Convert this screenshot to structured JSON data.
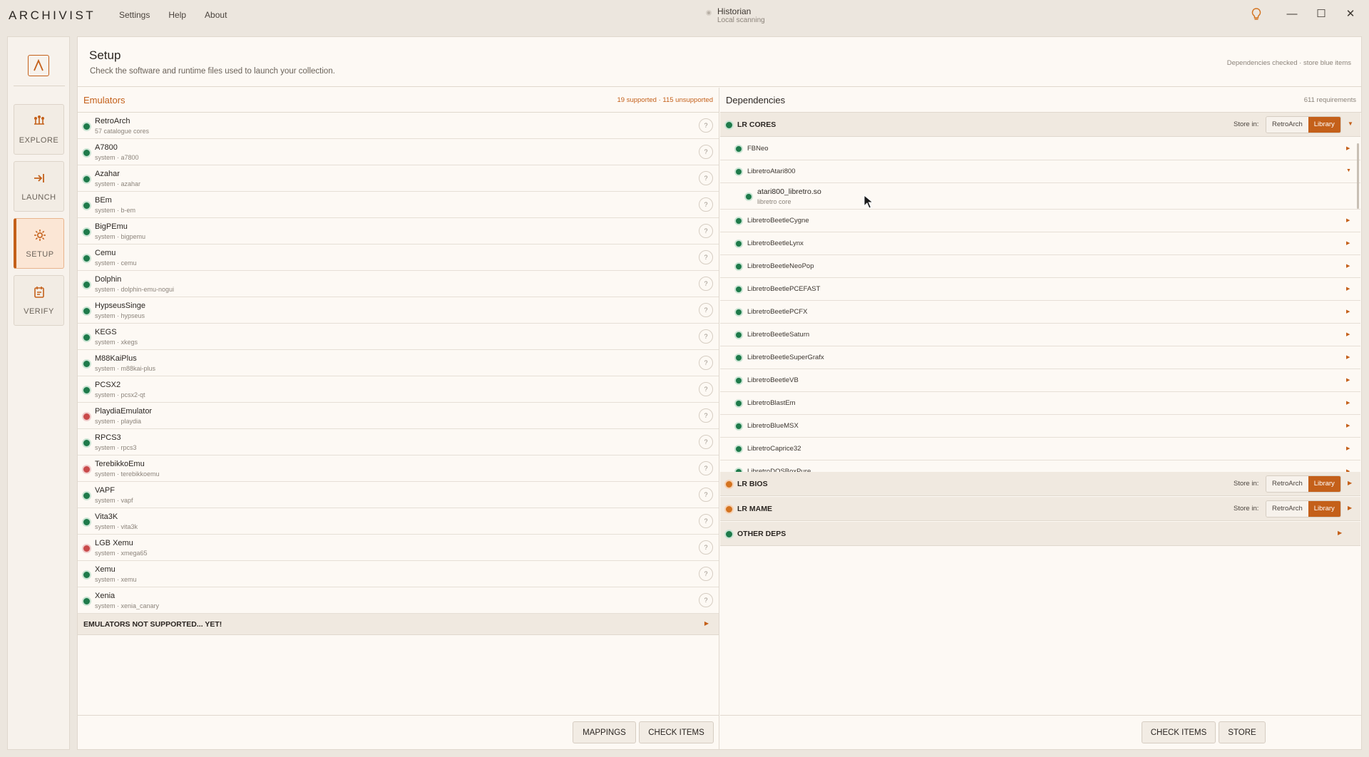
{
  "app": {
    "name": "ARCHIVIST"
  },
  "menu": [
    "Settings",
    "Help",
    "About"
  ],
  "profile": {
    "name": "Historian",
    "status": "Local scanning"
  },
  "window_controls": {
    "minimize": "—",
    "maximize": "☐",
    "close": "✕"
  },
  "sidebar": {
    "items": [
      {
        "label": "EXPLORE",
        "icon": "explore-icon",
        "active": false
      },
      {
        "label": "LAUNCH",
        "icon": "launch-icon",
        "active": false
      },
      {
        "label": "SETUP",
        "icon": "gear-icon",
        "active": true
      },
      {
        "label": "VERIFY",
        "icon": "verify-icon",
        "active": false
      }
    ]
  },
  "header": {
    "title": "Setup",
    "description": "Check the software and runtime files used to launch your collection.",
    "status": "Dependencies checked · store blue items"
  },
  "emulators": {
    "title": "Emulators",
    "counts": "19 supported · 115 unsupported",
    "items": [
      {
        "name": "RetroArch",
        "sub": "57 catalogue cores",
        "status": "ok"
      },
      {
        "name": "A7800",
        "sub": "system · a7800",
        "status": "ok"
      },
      {
        "name": "Azahar",
        "sub": "system · azahar",
        "status": "ok"
      },
      {
        "name": "BEm",
        "sub": "system · b-em",
        "status": "ok"
      },
      {
        "name": "BigPEmu",
        "sub": "system · bigpemu",
        "status": "ok"
      },
      {
        "name": "Cemu",
        "sub": "system · cemu",
        "status": "ok"
      },
      {
        "name": "Dolphin",
        "sub": "system · dolphin-emu-nogui",
        "status": "ok"
      },
      {
        "name": "HypseusSinge",
        "sub": "system · hypseus",
        "status": "ok"
      },
      {
        "name": "KEGS",
        "sub": "system · xkegs",
        "status": "ok"
      },
      {
        "name": "M88KaiPlus",
        "sub": "system · m88kai-plus",
        "status": "ok"
      },
      {
        "name": "PCSX2",
        "sub": "system · pcsx2-qt",
        "status": "ok"
      },
      {
        "name": "PlaydiaEmulator",
        "sub": "system · playdia",
        "status": "error"
      },
      {
        "name": "RPCS3",
        "sub": "system · rpcs3",
        "status": "ok"
      },
      {
        "name": "TerebikkoEmu",
        "sub": "system · terebikkoemu",
        "status": "error"
      },
      {
        "name": "VAPF",
        "sub": "system · vapf",
        "status": "ok"
      },
      {
        "name": "Vita3K",
        "sub": "system · vita3k",
        "status": "ok"
      },
      {
        "name": "LGB Xemu",
        "sub": "system · xmega65",
        "status": "error"
      },
      {
        "name": "Xemu",
        "sub": "system · xemu",
        "status": "ok"
      },
      {
        "name": "Xenia",
        "sub": "system · xenia_canary",
        "status": "ok"
      }
    ],
    "help_label": "?",
    "unsupported_label": "EMULATORS NOT SUPPORTED... YET!",
    "buttons": {
      "mappings": "MAPPINGS",
      "check": "CHECK ITEMS"
    }
  },
  "dependencies": {
    "title": "Dependencies",
    "count": "611 requirements",
    "store_label": "Store in:",
    "seg_a": "RetroArch",
    "seg_b": "Library",
    "groups": [
      {
        "name": "LR CORES",
        "status": "ok",
        "store": true,
        "expanded": true
      },
      {
        "name": "LR BIOS",
        "status": "warn",
        "store": true
      },
      {
        "name": "LR MAME",
        "status": "warn",
        "store": true
      },
      {
        "name": "OTHER DEPS",
        "status": "ok",
        "store": false
      }
    ],
    "cores": [
      "FBNeo",
      "LibretroAtari800",
      "LibretroBeetleCygne",
      "LibretroBeetleLynx",
      "LibretroBeetleNeoPop",
      "LibretroBeetlePCEFAST",
      "LibretroBeetlePCFX",
      "LibretroBeetleSaturn",
      "LibretroBeetleSuperGrafx",
      "LibretroBeetleVB",
      "LibretroBlastEm",
      "LibretroBlueMSX",
      "LibretroCaprice32",
      "LibretroDOSBoxPure"
    ],
    "expanded_file": {
      "name": "atari800_libretro.so",
      "sub": "libretro core"
    },
    "buttons": {
      "check": "CHECK ITEMS",
      "store": "STORE"
    }
  },
  "colors": {
    "accent": "#c4601a",
    "ok": "#1e7a4a",
    "error": "#c94a4a",
    "warn": "#d4731f"
  }
}
